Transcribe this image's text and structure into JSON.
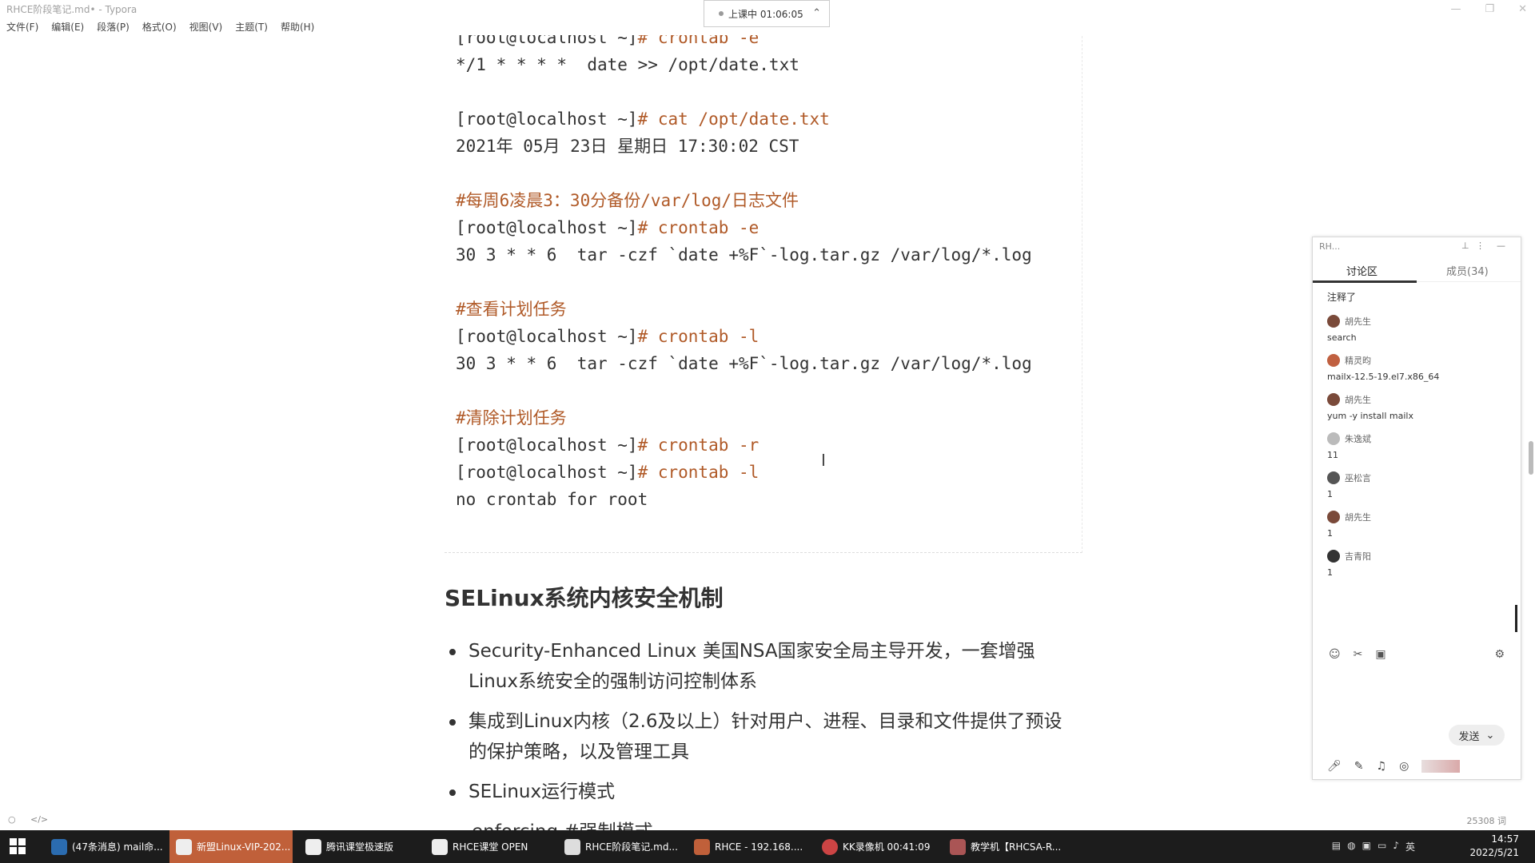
{
  "window": {
    "title": "RHCE阶段笔记.md• - Typora",
    "menu": [
      "文件(F)",
      "编辑(E)",
      "段落(P)",
      "格式(O)",
      "视图(V)",
      "主题(T)",
      "帮助(H)"
    ]
  },
  "overlay": {
    "timer": "上课中 01:06:05"
  },
  "code": {
    "lines": [
      {
        "prompt": "[root@localhost ~]",
        "cmd": "# crontab -e"
      },
      {
        "text": "*/1 * * * *  date >> /opt/date.txt"
      },
      {
        "text": ""
      },
      {
        "prompt": "[root@localhost ~]",
        "cmd": "# cat /opt/date.txt"
      },
      {
        "text": "2021年 05月 23日 星期日 17:30:02 CST"
      },
      {
        "text": ""
      },
      {
        "comment": "#每周6凌晨3：30分备份/var/log/日志文件"
      },
      {
        "prompt": "[root@localhost ~]",
        "cmd": "# crontab -e"
      },
      {
        "text": "30 3 * * 6  tar -czf `date +%F`-log.tar.gz /var/log/*.log"
      },
      {
        "text": ""
      },
      {
        "comment": "#查看计划任务"
      },
      {
        "prompt": "[root@localhost ~]",
        "cmd": "# crontab -l"
      },
      {
        "text": "30 3 * * 6  tar -czf `date +%F`-log.tar.gz /var/log/*.log"
      },
      {
        "text": ""
      },
      {
        "comment": "#清除计划任务"
      },
      {
        "prompt": "[root@localhost ~]",
        "cmd": "# crontab -r"
      },
      {
        "prompt": "[root@localhost ~]",
        "cmd": "# crontab -l"
      },
      {
        "text": "no crontab for root"
      }
    ]
  },
  "section": {
    "heading": "SELinux系统内核安全机制",
    "bullets": [
      [
        "Security-Enhanced Linux 美国NSA国家安全局主导开发，一套增强",
        "Linux系统安全的强制访问控制体系"
      ],
      [
        "集成到Linux内核（2.6及以上）针对用户、进程、目录和文件提供了预设",
        "的保护策略，以及管理工具"
      ],
      [
        "SELinux运行模式"
      ]
    ],
    "sub_bullet": "enforcing        #强制模式"
  },
  "statusbar": {
    "word_count": "25308 词"
  },
  "chat": {
    "header": "RH...",
    "tab_active": "讨论区",
    "tab_members": "成员(34)",
    "top_text": "注释了",
    "messages": [
      {
        "user": "胡先生",
        "text": "search"
      },
      {
        "user": "精灵昀",
        "text": "mailx-12.5-19.el7.x86_64"
      },
      {
        "user": "胡先生",
        "text": "yum -y install mailx"
      },
      {
        "user": "朱逸斌",
        "text": "11"
      },
      {
        "user": "巫松言",
        "text": "1"
      },
      {
        "user": "胡先生",
        "text": "1"
      },
      {
        "user": "吉青阳",
        "text": "1"
      }
    ],
    "send": "发送"
  },
  "taskbar": {
    "tasks": [
      {
        "label": "(47条消息) mail命..."
      },
      {
        "label": "新盟Linux-VIP-202..."
      },
      {
        "label": "腾讯课堂极速版"
      },
      {
        "label": "RHCE课堂 OPEN"
      },
      {
        "label": "RHCE阶段笔记.md..."
      },
      {
        "label": "RHCE  - 192.168...."
      },
      {
        "label": "KK录像机 00:41:09"
      },
      {
        "label": "教学机【RHCSA-R..."
      }
    ],
    "ime": "英",
    "time": "14:57",
    "date": "2022/5/21"
  }
}
